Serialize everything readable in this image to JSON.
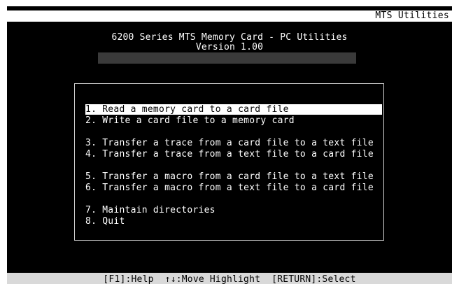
{
  "app": {
    "window_title": "MTS Utilities"
  },
  "header": {
    "title": "6200 Series MTS Memory Card - PC Utilities",
    "version": "Version 1.00"
  },
  "menu": {
    "selected_index": 0,
    "items": [
      {
        "label": "1. Read a memory card to a card file"
      },
      {
        "label": "2. Write a card file to a memory card"
      },
      {
        "label": "3. Transfer a trace from a card file to a text file"
      },
      {
        "label": "4. Transfer a trace from a text file to a card file"
      },
      {
        "label": "5. Transfer a macro from a card file to a text file"
      },
      {
        "label": "6. Transfer a macro from a text file to a card file"
      },
      {
        "label": "7. Maintain directories"
      },
      {
        "label": "8. Quit"
      }
    ]
  },
  "status_bar": {
    "text": "[F1]:Help  ↑↓:Move Highlight  [RETURN]:Select"
  },
  "colors": {
    "screen_background": "#000000",
    "text": "#ffffff",
    "highlight_background": "#ffffff",
    "highlight_text": "#000000",
    "status_bar_background": "#d9d9d9"
  }
}
